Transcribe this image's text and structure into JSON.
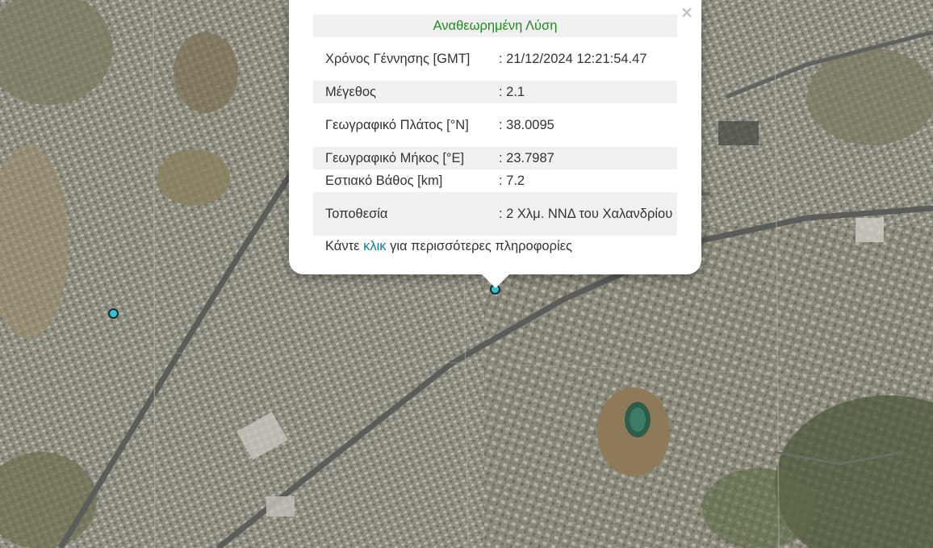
{
  "map": {
    "markers": [
      {
        "name": "epicenter-marker-left",
        "color": "#2ec4d6"
      },
      {
        "name": "epicenter-marker-selected",
        "color": "#2ec4d6"
      }
    ]
  },
  "popup": {
    "close_glyph": "×",
    "title": "Αναθεωρημένη Λύση",
    "rows": [
      {
        "label": "Χρόνος Γέννησης [GMT]",
        "value": ": 21/12/2024 12:21:54.47"
      },
      {
        "label": "Μέγεθος",
        "value": ": 2.1"
      },
      {
        "label": "Γεωγραφικό Πλάτος [°N]",
        "value": ": 38.0095"
      },
      {
        "label": "Γεωγραφικό Μήκος [°E]",
        "value": ": 23.7987"
      },
      {
        "label": "Εστιακό Βάθος [km]",
        "value": ": 7.2"
      },
      {
        "label": "Τοποθεσία",
        "value": ": 2 Χλμ. ΝΝΔ του Χαλανδρίου"
      }
    ],
    "more_prefix": "Κάντε ",
    "more_link": "κλικ",
    "more_suffix": " για περισσότερες πληροφορίες"
  },
  "colors": {
    "title": "#1f8a1f",
    "link": "#0c7c9c",
    "marker": "#2ec4d6"
  }
}
